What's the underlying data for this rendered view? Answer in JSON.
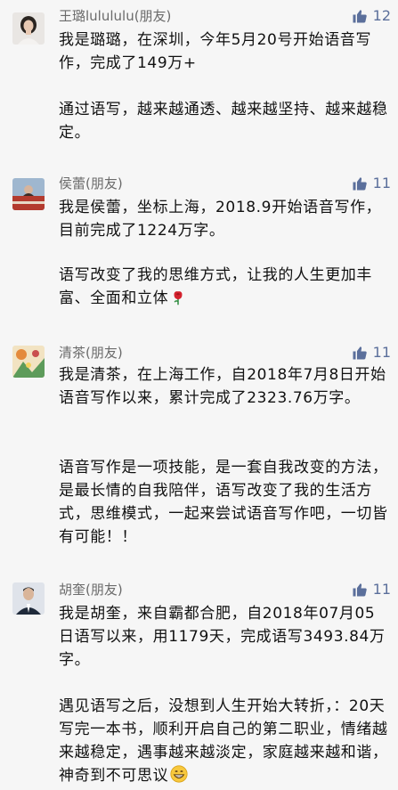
{
  "comments": [
    {
      "name": "王璐lulululu(朋友)",
      "likes": "12",
      "avatar_icon": "woman-portrait-icon",
      "paragraphs": [
        "我是璐璐，在深圳，今年5月20号开始语音写作，完成了149万+",
        "通过语写，越来越通透、越来越坚持、越来越稳定。"
      ]
    },
    {
      "name": "侯蕾(朋友)",
      "likes": "11",
      "avatar_icon": "landscape-photo-icon",
      "paragraphs": [
        "我是侯蕾，坐标上海，2018.9开始语音写作，目前完成了1224万字。",
        "语写改变了我的思维方式，让我的人生更加丰富、全面和立体"
      ]
    },
    {
      "name": "清茶(朋友)",
      "likes": "11",
      "avatar_icon": "illustration-icon",
      "paragraphs": [
        "我是清茶，在上海工作，自2018年7月8日开始语音写作以来，累计完成了2323.76万字。",
        "语音写作是一项技能，是一套自我改变的方法，是最长情的自我陪伴，语写改变了我的生活方式，思维模式，一起来尝试语音写作吧，一切皆有可能！！"
      ]
    },
    {
      "name": "胡奎(朋友)",
      "likes": "11",
      "avatar_icon": "man-portrait-icon",
      "paragraphs": [
        "我是胡奎，来自霸都合肥，自2018年07月05日语写以来，用1179天，完成语写3493.84万字。",
        "遇见语写之后，没想到人生开始大转折，：20天写完一本书，顺利开启自己的第二职业，情绪越来越稳定，遇事越来越淡定，家庭越来越和谐，神奇到不可思议"
      ]
    }
  ],
  "icons": {
    "like": "thumbs-up-icon",
    "rose": "rose-icon",
    "grin": "grinning-face-icon"
  },
  "colors": {
    "background": "#f6f6f6",
    "name_text": "#6b6b6b",
    "like_accent": "#5b6f9b",
    "body_text": "#111111"
  }
}
